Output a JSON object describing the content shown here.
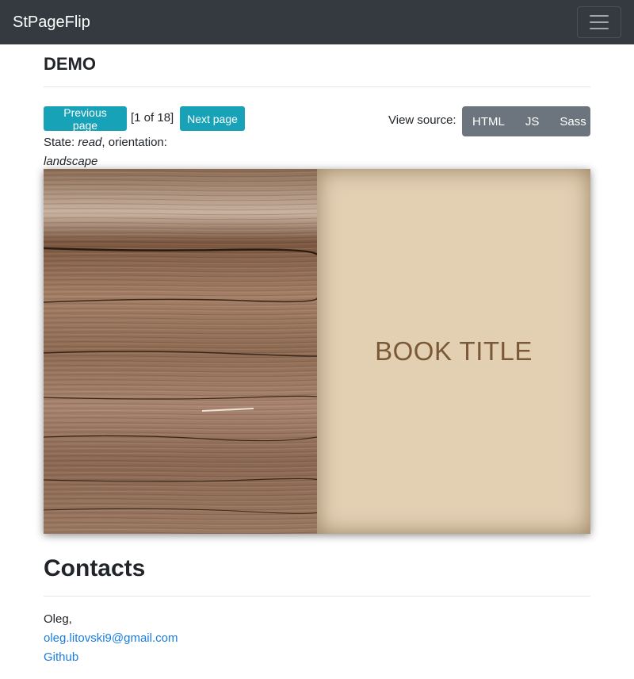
{
  "navbar": {
    "brand": "StPageFlip",
    "menu_icon": "hamburger-menu-icon"
  },
  "demo": {
    "title": "DEMO",
    "prev_label": "Previous page",
    "page_counter": "[1 of 18]",
    "next_label": "Next page",
    "state_label": "State: ",
    "state_value": "read",
    "orientation_label": ", orientation: ",
    "orientation_value": "landscape",
    "view_source_label": "View source:",
    "source_buttons": [
      "HTML",
      "JS",
      "Sass"
    ]
  },
  "book": {
    "cover_title": "BOOK TITLE",
    "cover_color": "#e3d0b3",
    "title_color": "#7a5a36"
  },
  "contacts": {
    "title": "Contacts",
    "name": "Oleg,",
    "email": "oleg.litovski9@gmail.com",
    "github": "Github"
  },
  "colors": {
    "navbar": "#343a40",
    "info_button": "#17a2b8",
    "secondary_button": "#6c757d",
    "link": "#1a7ee0"
  }
}
